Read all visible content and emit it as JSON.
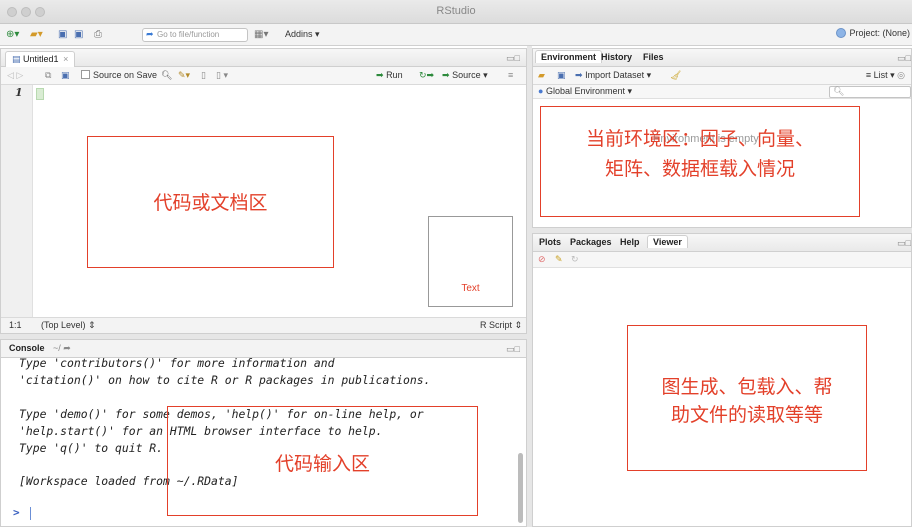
{
  "window": {
    "title": "RStudio"
  },
  "toolbar": {
    "goto_placeholder": "Go to file/function",
    "addins_label": "Addins",
    "addins_chevron": "▾",
    "project_label": "Project: (None)"
  },
  "source": {
    "tab_label": "Untitled1",
    "tab_close": "×",
    "source_on_save": "Source on Save",
    "run_label": "Run",
    "source_label": "Source",
    "line_number": "1",
    "status_position": "1:1",
    "status_scope": "(Top Level) ⇕",
    "status_filetype": "R Script ⇕"
  },
  "console": {
    "title": "Console",
    "path": "~/",
    "lines": [
      "Type 'contributors()' for more information and",
      "'citation()' on how to cite R or R packages in publications.",
      "",
      "Type 'demo()' for some demos, 'help()' for on-line help, or",
      "'help.start()' for an HTML browser interface to help.",
      "Type 'q()' to quit R.",
      "",
      "[Workspace loaded from ~/.RData]"
    ],
    "prompt": ">"
  },
  "environment": {
    "tabs": [
      "Environment",
      "History",
      "Files"
    ],
    "import_dataset": "Import Dataset ▾",
    "list_label": "List ▾",
    "scope_label": "Global Environment ▾",
    "empty_text": "Environment is empty"
  },
  "viewer": {
    "tabs": [
      "Plots",
      "Packages",
      "Help",
      "Viewer"
    ]
  },
  "annotations": {
    "code_area": "代码或文档区",
    "console_area": "代码输入区",
    "env_area_line1": "当前环境区：因子、向量、",
    "env_area_line2": "矩阵、数据框载入情况",
    "viewer_area_line1": "图生成、包载入、帮",
    "viewer_area_line2": "助文件的读取等等",
    "text_box": "Text"
  },
  "colors": {
    "annotation": "#e3402a",
    "prompt": "#3a60c0"
  }
}
